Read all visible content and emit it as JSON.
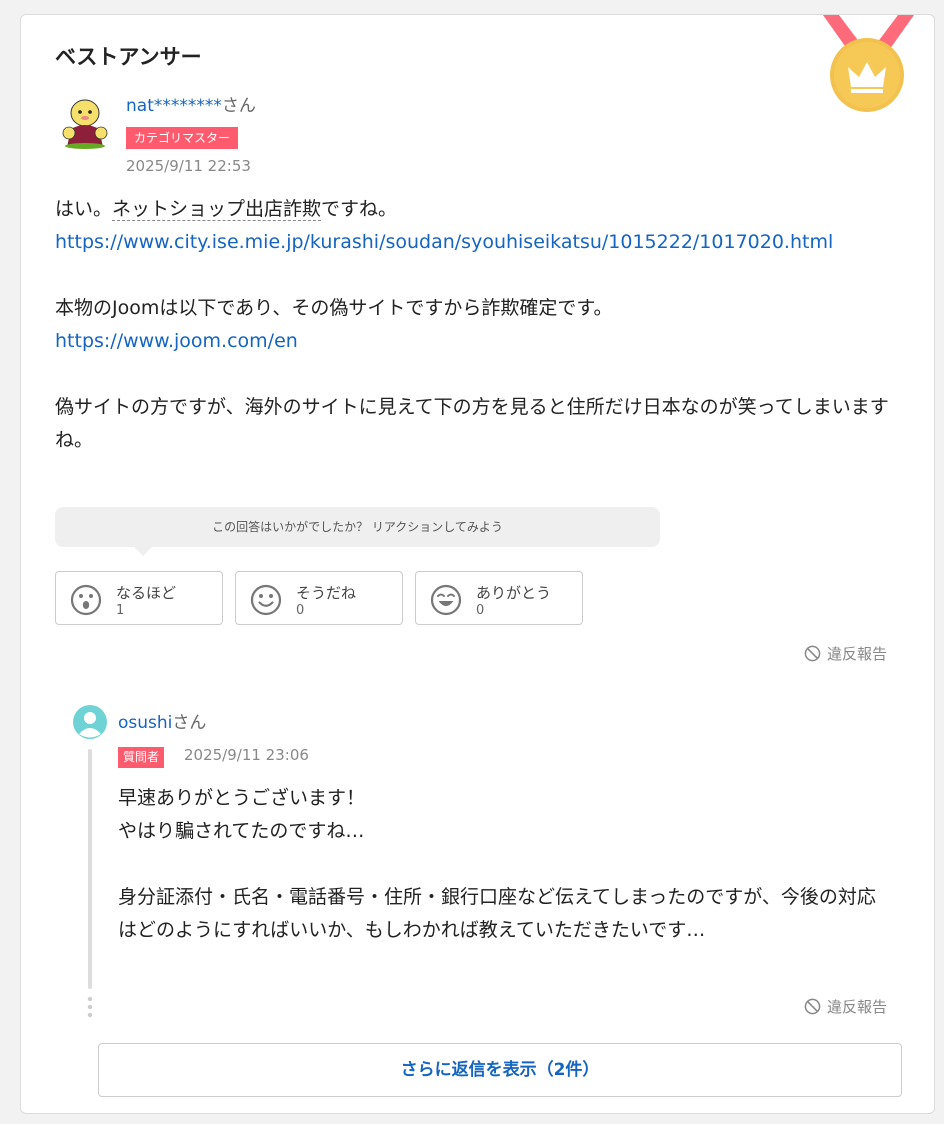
{
  "section": {
    "title": "ベストアンサー",
    "medal_icon": "crown-medal-icon"
  },
  "answer": {
    "username": "nat********",
    "honorific": "さん",
    "badge": "カテゴリマスター",
    "timestamp": "2025/9/11 22:53",
    "body": {
      "p1_prefix": "はい。",
      "p1_keyword": "ネットショップ出店詐欺",
      "p1_suffix": "ですね。",
      "link1": "https://www.city.ise.mie.jp/kurashi/soudan/syouhiseikatsu/1015222/1017020.html",
      "p2": "本物のJoomは以下であり、その偽サイトですから詐欺確定です。",
      "link2": "https://www.joom.com/en",
      "p3": "偽サイトの方ですが、海外のサイトに見えて下の方を見ると住所だけ日本なのが笑ってしまいますね。"
    },
    "reaction_prompt": "この回答はいかがでしたか？ リアクションしてみよう",
    "reactions": [
      {
        "label": "なるほど",
        "count": "1",
        "icon": "surprised-face-icon"
      },
      {
        "label": "そうだね",
        "count": "0",
        "icon": "smile-face-icon"
      },
      {
        "label": "ありがとう",
        "count": "0",
        "icon": "grin-face-icon"
      }
    ],
    "report_label": "違反報告"
  },
  "reply": {
    "username": "osushi",
    "honorific": "さん",
    "badge": "質問者",
    "timestamp": "2025/9/11 23:06",
    "lines": [
      "早速ありがとうございます！",
      "やはり騙されてたのですね…",
      "",
      "身分証添付・氏名・電話番号・住所・銀行口座など伝えてしまったのですが、今後の対応はどのようにすればいいか、もしわかれば教えていただきたいです…"
    ],
    "report_label": "違反報告"
  },
  "more_replies_label": "さらに返信を表示（2件）",
  "colors": {
    "link": "#1565c0",
    "badge": "#ff5b6e",
    "medal": "#f2c14e",
    "ribbon": "#ff6b7a"
  }
}
